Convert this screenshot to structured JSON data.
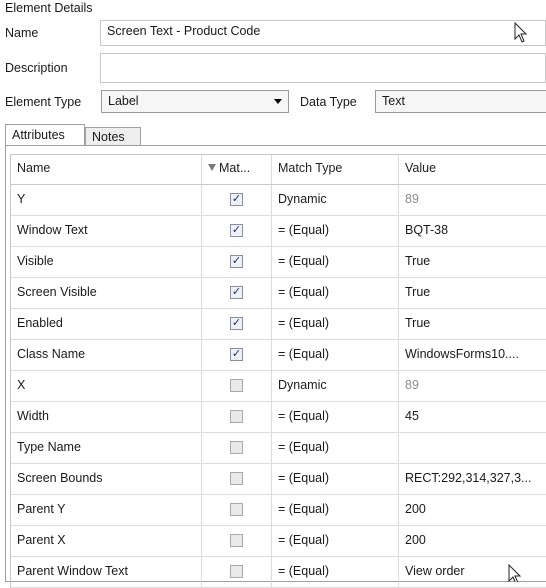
{
  "details": {
    "section_title": "Element Details",
    "name_label": "Name",
    "name_value": "Screen Text - Product Code",
    "description_label": "Description",
    "description_value": "",
    "element_type_label": "Element Type",
    "element_type_value": "Label",
    "data_type_label": "Data Type",
    "data_type_value": "Text"
  },
  "tabs": {
    "attributes": "Attributes",
    "notes": "Notes"
  },
  "grid": {
    "headers": {
      "name": "Name",
      "match": "Mat...",
      "match_type": "Match Type",
      "value": "Value"
    },
    "rows": [
      {
        "name": "Y",
        "checked": true,
        "match_type": "Dynamic",
        "value": "89",
        "dim": true
      },
      {
        "name": "Window Text",
        "checked": true,
        "match_type": "=  (Equal)",
        "value": "BQT-38",
        "dim": false
      },
      {
        "name": "Visible",
        "checked": true,
        "match_type": "=  (Equal)",
        "value": "True",
        "dim": false
      },
      {
        "name": "Screen Visible",
        "checked": true,
        "match_type": "=  (Equal)",
        "value": "True",
        "dim": false
      },
      {
        "name": "Enabled",
        "checked": true,
        "match_type": "=  (Equal)",
        "value": "True",
        "dim": false
      },
      {
        "name": "Class Name",
        "checked": true,
        "match_type": "=  (Equal)",
        "value": "WindowsForms10....",
        "dim": false
      },
      {
        "name": "X",
        "checked": false,
        "match_type": "Dynamic",
        "value": "89",
        "dim": true
      },
      {
        "name": "Width",
        "checked": false,
        "match_type": "=  (Equal)",
        "value": "45",
        "dim": false
      },
      {
        "name": "Type Name",
        "checked": false,
        "match_type": "=  (Equal)",
        "value": "",
        "dim": false
      },
      {
        "name": "Screen Bounds",
        "checked": false,
        "match_type": "=  (Equal)",
        "value": "RECT:292,314,327,3...",
        "dim": false
      },
      {
        "name": "Parent Y",
        "checked": false,
        "match_type": "=  (Equal)",
        "value": "200",
        "dim": false
      },
      {
        "name": "Parent X",
        "checked": false,
        "match_type": "=  (Equal)",
        "value": "200",
        "dim": false
      },
      {
        "name": "Parent Window Text",
        "checked": false,
        "match_type": "=  (Equal)",
        "value": "View order",
        "dim": false
      }
    ]
  },
  "icons": {
    "filter": "filter-icon",
    "dropdown": "chevron-down-icon",
    "cursor": "mouse-pointer-icon"
  }
}
